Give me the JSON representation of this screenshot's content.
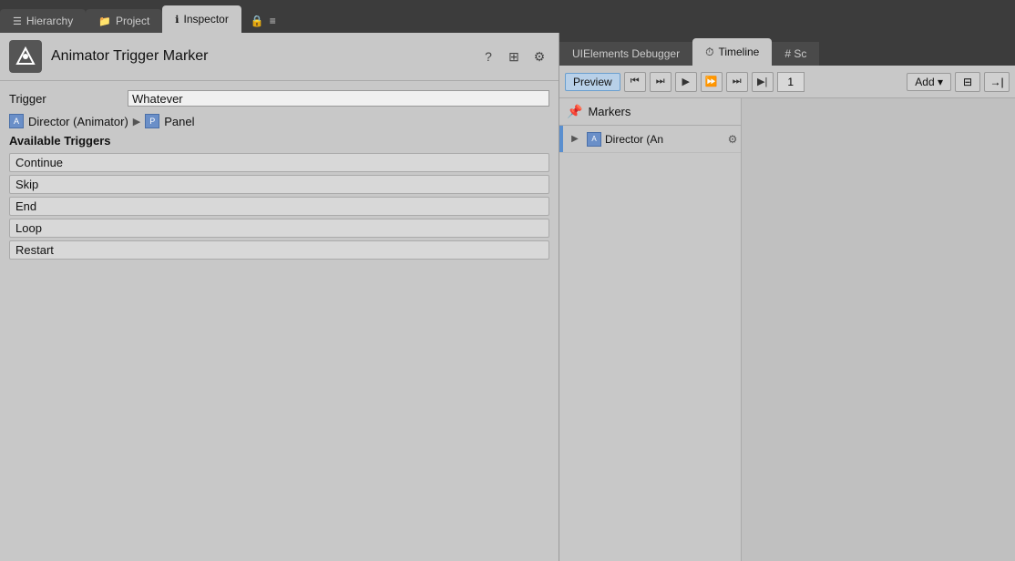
{
  "tabs": [
    {
      "id": "hierarchy",
      "label": "Hierarchy",
      "icon": "☰",
      "active": false
    },
    {
      "id": "project",
      "label": "Project",
      "icon": "📁",
      "active": false
    },
    {
      "id": "inspector",
      "label": "Inspector",
      "icon": "ℹ",
      "active": true
    }
  ],
  "lock_icon": "🔒",
  "menu_icon": "≡",
  "inspector": {
    "title": "Animator Trigger Marker",
    "trigger_label": "Trigger",
    "trigger_value": "Whatever",
    "director_label": "Director (Animator)",
    "panel_label": "Panel",
    "available_triggers_label": "Available Triggers",
    "triggers": [
      "Continue",
      "Skip",
      "End",
      "Loop",
      "Restart"
    ],
    "icons": {
      "help": "?",
      "layout": "⊞",
      "settings": "⚙"
    }
  },
  "timeline": {
    "tabs": [
      {
        "id": "uidebugger",
        "label": "UIElements Debugger",
        "active": false
      },
      {
        "id": "timeline",
        "label": "Timeline",
        "icon": "⏱",
        "active": true
      },
      {
        "id": "sc",
        "label": "# Sc",
        "active": false
      }
    ],
    "toolbar": {
      "preview_label": "Preview",
      "add_label": "Add ▾",
      "frame_number": "1",
      "transport_buttons": [
        "⏮",
        "⏭",
        "◀",
        "▶",
        "⏩",
        "⏮⏮",
        "▶|"
      ]
    },
    "markers_label": "Markers",
    "tracks": [
      {
        "name": "Director (An",
        "color": "#5a8fcf"
      }
    ]
  }
}
